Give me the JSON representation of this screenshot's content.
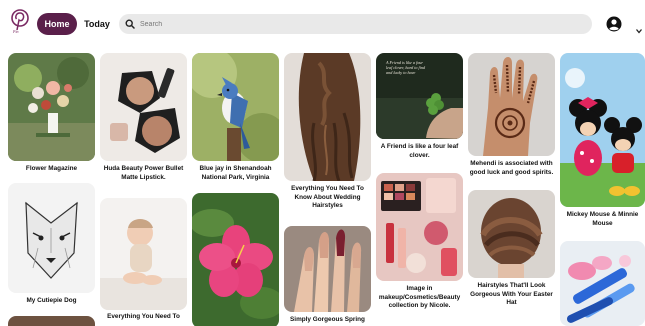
{
  "header": {
    "home_label": "Home",
    "today_label": "Today",
    "search_placeholder": "Search"
  },
  "pins": [
    {
      "caption": "Flower Magazine"
    },
    {
      "caption": "My Cutiepie Dog"
    },
    {
      "caption": "Huda Beauty Power Bullet Matte Lipstick."
    },
    {
      "caption": "Everything You Need To"
    },
    {
      "caption": "Blue jay in Shenandoah National Park, Virginia"
    },
    {
      "caption": "Everything You Need To Know About Wedding Hairstyles"
    },
    {
      "caption": "Simply Gorgeous Spring"
    },
    {
      "caption": "A Friend is like a four leaf clover.",
      "overlay_text": "A Friend is like a four leaf clover, hard to find and lucky to have"
    },
    {
      "caption": "Image in makeup/Cosmetics/Beauty collection by Nicole."
    },
    {
      "caption": "Mehendi is associated with good luck and good spirits."
    },
    {
      "caption": "Hairstyles That'll Look Gorgeous With Your Easter Hat"
    },
    {
      "caption": "Mickey Mouse & Minnie Mouse"
    }
  ],
  "icons": {
    "logo": "pinterest-logo-icon",
    "search": "search-icon",
    "profile": "profile-icon",
    "menu": "chevron-down-icon"
  }
}
